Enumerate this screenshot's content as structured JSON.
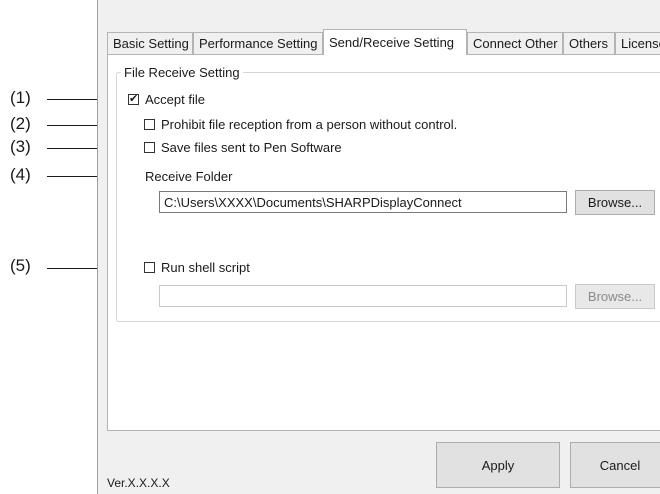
{
  "tabs": [
    "Basic Setting",
    "Performance Setting",
    "Send/Receive Setting",
    "Connect Other",
    "Others",
    "License"
  ],
  "active_tab": "Send/Receive Setting",
  "group": {
    "title": "File Receive Setting",
    "accept_file": {
      "label": "Accept file",
      "checked": true
    },
    "prohibit": {
      "label": "Prohibit file reception from a person without control.",
      "checked": false
    },
    "save_files": {
      "label": "Save files sent to Pen Software",
      "checked": false
    },
    "receive_folder_label": "Receive Folder",
    "receive_folder_value": "C:\\Users\\XXXX\\Documents\\SHARPDisplayConnect",
    "browse_label": "Browse...",
    "run_shell": {
      "label": "Run shell script",
      "checked": false
    },
    "shell_value": "",
    "browse2_label": "Browse..."
  },
  "buttons": {
    "apply": "Apply",
    "cancel": "Cancel"
  },
  "version": "Ver.X.X.X.X",
  "callouts": [
    "(1)",
    "(2)",
    "(3)",
    "(4)",
    "(5)"
  ],
  "check_glyph": "✔"
}
